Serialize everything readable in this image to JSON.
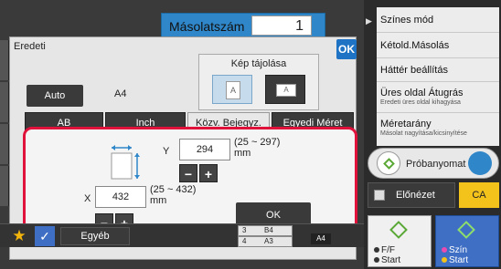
{
  "copies": {
    "label": "Másolatszám",
    "value": "1"
  },
  "dialog": {
    "title": "Eredeti",
    "ok_label": "OK",
    "orientation_title": "Kép tájolása",
    "orientation_portrait_glyph": "A",
    "orientation_landscape_glyph": "A",
    "auto_label": "Auto",
    "auto_value": "A4",
    "tabs": [
      "AB",
      "Inch",
      "Közv. Bejegyz.",
      "Egyedi Méret"
    ],
    "active_tab": "Közv. Bejegyz.",
    "y": {
      "label": "Y",
      "value": "294",
      "range": "(25 ~ 297)",
      "unit": "mm"
    },
    "x": {
      "label": "X",
      "value": "432",
      "range": "(25 ~ 432)",
      "unit": "mm"
    },
    "ok_button": "OK",
    "highlight_color": "#e0123c"
  },
  "bottom": {
    "other_label": "Egyéb",
    "trays": [
      {
        "num": "3",
        "size": "B4"
      },
      {
        "num": "4",
        "size": "A3"
      }
    ],
    "badge": "A4"
  },
  "right_menu": [
    {
      "title": "Színes mód",
      "sub": ""
    },
    {
      "title": "Kétold.Másolás",
      "sub": ""
    },
    {
      "title": "Háttér beállítás",
      "sub": ""
    },
    {
      "title": "Üres oldal Átugrás",
      "sub": "Eredeti üres oldal kihagyása"
    },
    {
      "title": "Méretarány",
      "sub": "Másolat nagyítása/kicsinyítése"
    }
  ],
  "preview": {
    "proof_label": "Próbanyomat",
    "preview_label": "Előnézet",
    "ca_label": "CA"
  },
  "start": {
    "ff": {
      "line1": "F/F",
      "line2": "Start"
    },
    "color": {
      "line1": "Szín",
      "line2": "Start"
    }
  },
  "colors": {
    "accent_blue": "#2f86c8",
    "start_blue": "#3e6fc5",
    "ca_yellow": "#f3c21b",
    "star_yellow": "#f3b40b"
  }
}
